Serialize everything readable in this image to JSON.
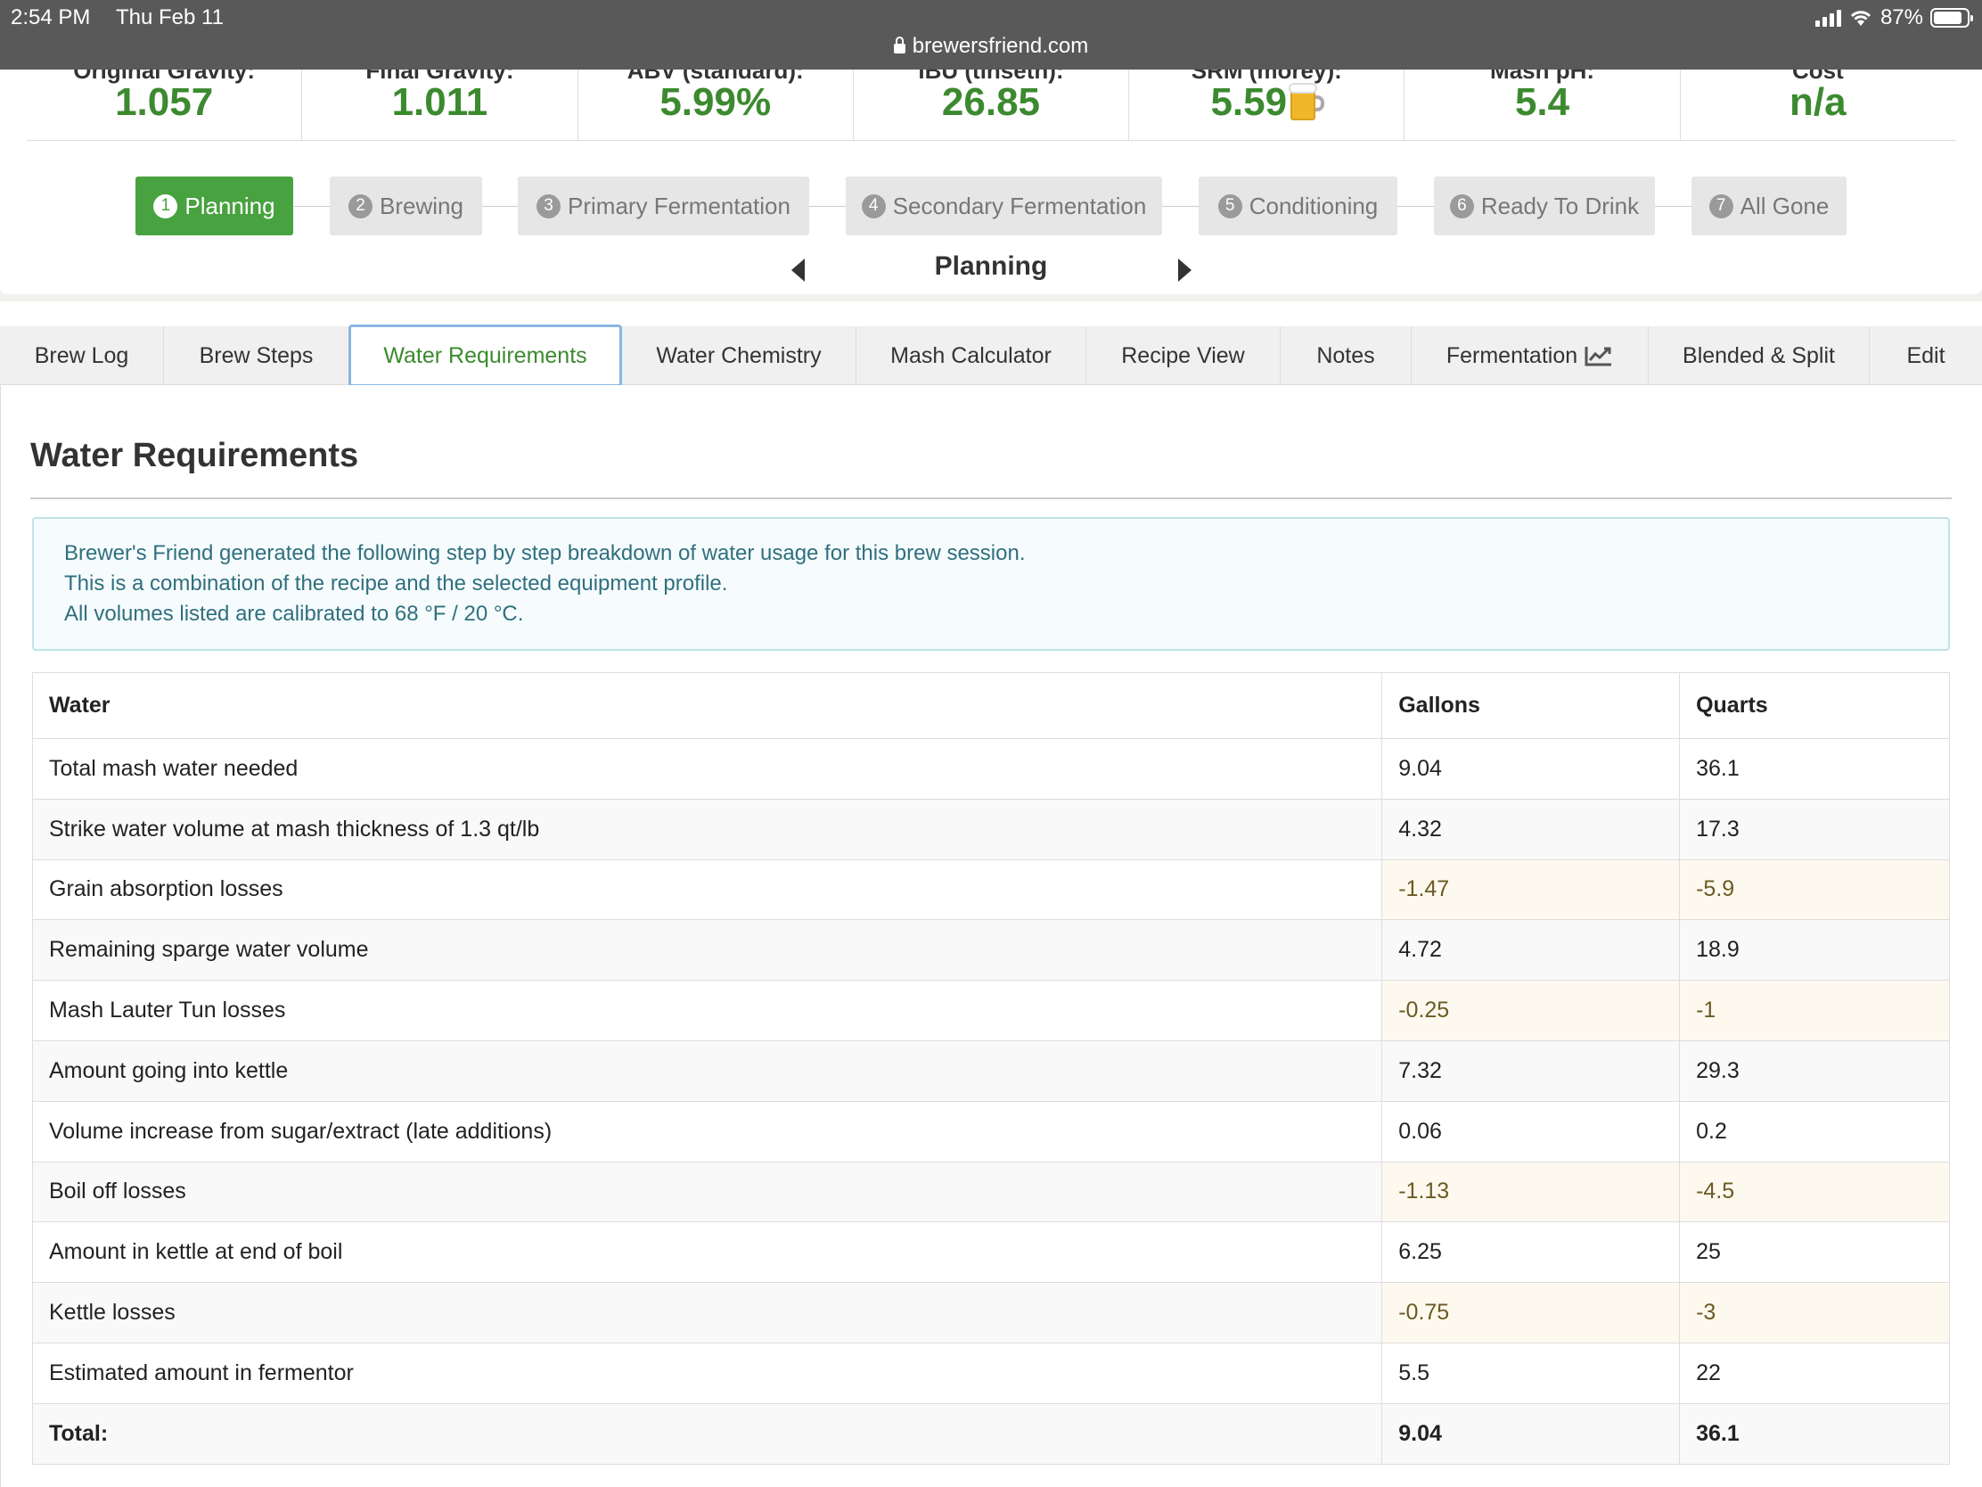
{
  "status_bar": {
    "time": "2:54 PM",
    "date": "Thu Feb 11",
    "battery": "87%",
    "url": "brewersfriend.com"
  },
  "stats": [
    {
      "label": "Original Gravity:",
      "value": "1.057"
    },
    {
      "label": "Final Gravity:",
      "value": "1.011"
    },
    {
      "label": "ABV (standard):",
      "value": "5.99%"
    },
    {
      "label": "IBU (tinseth):",
      "value": "26.85"
    },
    {
      "label": "SRM (morey):",
      "value": "5.59"
    },
    {
      "label": "Mash pH:",
      "value": "5.4"
    },
    {
      "label": "Cost",
      "value": "n/a"
    }
  ],
  "steps": [
    {
      "num": "1",
      "label": "Planning"
    },
    {
      "num": "2",
      "label": "Brewing"
    },
    {
      "num": "3",
      "label": "Primary Fermentation"
    },
    {
      "num": "4",
      "label": "Secondary Fermentation"
    },
    {
      "num": "5",
      "label": "Conditioning"
    },
    {
      "num": "6",
      "label": "Ready To Drink"
    },
    {
      "num": "7",
      "label": "All Gone"
    }
  ],
  "current_stage": "Planning",
  "tabs": [
    "Brew Log",
    "Brew Steps",
    "Water Requirements",
    "Water Chemistry",
    "Mash Calculator",
    "Recipe View",
    "Notes",
    "Fermentation",
    "Blended & Split",
    "Edit"
  ],
  "section_title": "Water Requirements",
  "info_lines": [
    "Brewer's Friend generated the following step by step breakdown of water usage for this brew session.",
    "This is a combination of the recipe and the selected equipment profile.",
    "All volumes listed are calibrated to 68 °F / 20 °C."
  ],
  "table": {
    "headers": [
      "Water",
      "Gallons",
      "Quarts"
    ],
    "rows": [
      [
        "Total mash water needed",
        "9.04",
        "36.1"
      ],
      [
        "Strike water volume at mash thickness of 1.3 qt/lb",
        "4.32",
        "17.3"
      ],
      [
        "Grain absorption losses",
        "-1.47",
        "-5.9"
      ],
      [
        "Remaining sparge water volume",
        "4.72",
        "18.9"
      ],
      [
        "Mash Lauter Tun losses",
        "-0.25",
        "-1"
      ],
      [
        "Amount going into kettle",
        "7.32",
        "29.3"
      ],
      [
        "Volume increase from sugar/extract (late additions)",
        "0.06",
        "0.2"
      ],
      [
        "Boil off losses",
        "-1.13",
        "-4.5"
      ],
      [
        "Amount in kettle at end of boil",
        "6.25",
        "25"
      ],
      [
        "Kettle losses",
        "-0.75",
        "-3"
      ],
      [
        "Estimated amount in fermentor",
        "5.5",
        "22"
      ]
    ],
    "total": [
      "Total:",
      "9.04",
      "36.1"
    ]
  }
}
